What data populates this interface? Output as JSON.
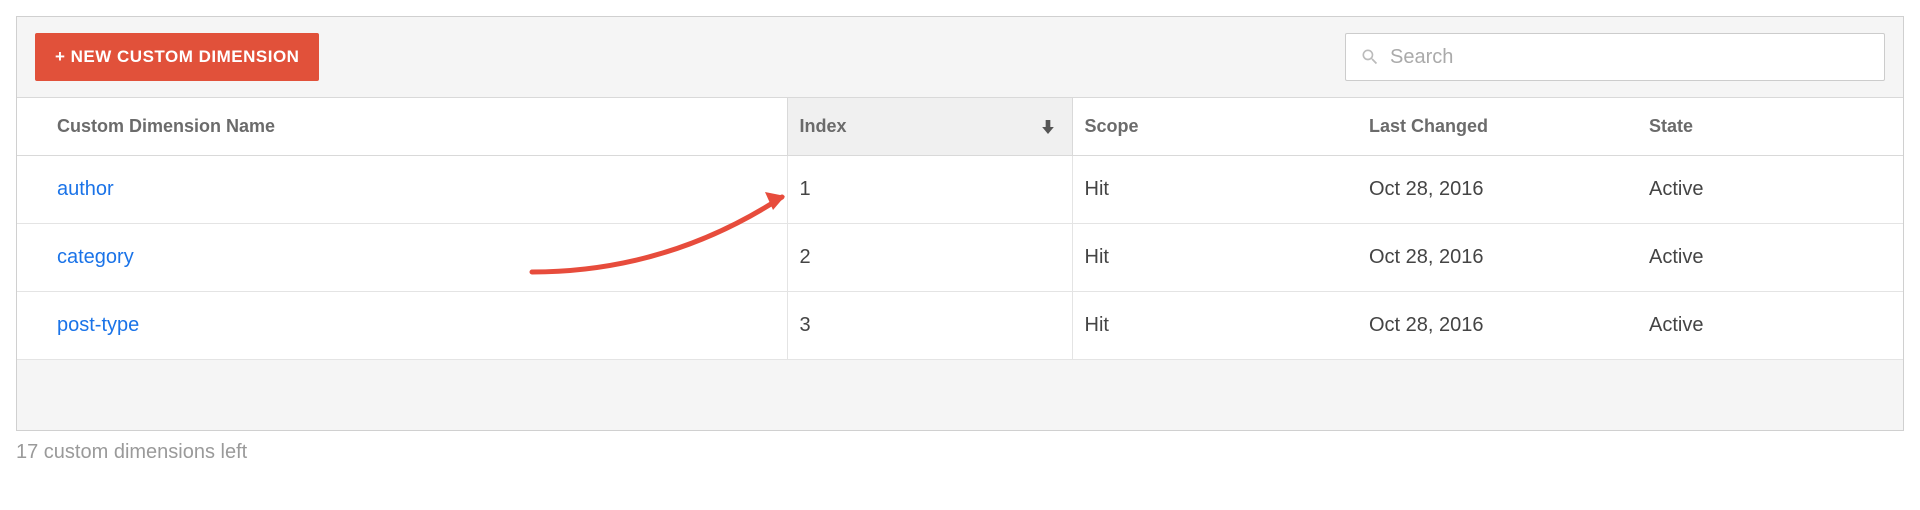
{
  "toolbar": {
    "new_button_label": "+ NEW CUSTOM DIMENSION",
    "search_placeholder": "Search"
  },
  "table": {
    "columns": {
      "name": "Custom Dimension Name",
      "index": "Index",
      "scope": "Scope",
      "last_changed": "Last Changed",
      "state": "State"
    },
    "rows": [
      {
        "name": "author",
        "index": "1",
        "scope": "Hit",
        "last_changed": "Oct 28, 2016",
        "state": "Active"
      },
      {
        "name": "category",
        "index": "2",
        "scope": "Hit",
        "last_changed": "Oct 28, 2016",
        "state": "Active"
      },
      {
        "name": "post-type",
        "index": "3",
        "scope": "Hit",
        "last_changed": "Oct 28, 2016",
        "state": "Active"
      }
    ]
  },
  "footer": {
    "remaining_text": "17 custom dimensions left"
  }
}
